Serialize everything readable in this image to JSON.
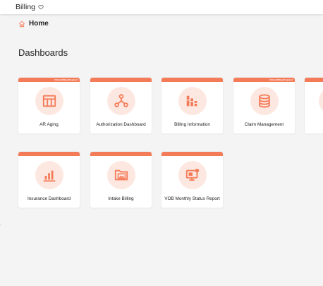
{
  "header": {
    "app_title": "Billing",
    "favorite_icon": "heart-outline-icon"
  },
  "breadcrumb": {
    "icon": "home-icon",
    "label": "Home"
  },
  "section": {
    "title": "Dashboards"
  },
  "colors": {
    "accent": "#f47b58",
    "icon_background": "#fde8e1",
    "page_background": "#f4f4f4"
  },
  "cards": [
    {
      "label": "AR Aging",
      "icon": "table-icon",
      "badge": "Yellow Billing Required"
    },
    {
      "label": "Authorization Dashboard",
      "icon": "share-nodes-icon",
      "badge": ""
    },
    {
      "label": "Billing Information",
      "icon": "bar-chart-icon",
      "badge": ""
    },
    {
      "label": "Claim Management",
      "icon": "database-icon",
      "badge": "Yellow Billing Required"
    },
    {
      "label": "",
      "icon": "partial-card",
      "badge": ""
    },
    {
      "label": "Insurance Dashboard",
      "icon": "column-chart-icon",
      "badge": ""
    },
    {
      "label": "Intake Billing",
      "icon": "folder-image-icon",
      "badge": ""
    },
    {
      "label": "VOB Monthly Status Report",
      "icon": "monitor-report-icon",
      "badge": ""
    }
  ]
}
